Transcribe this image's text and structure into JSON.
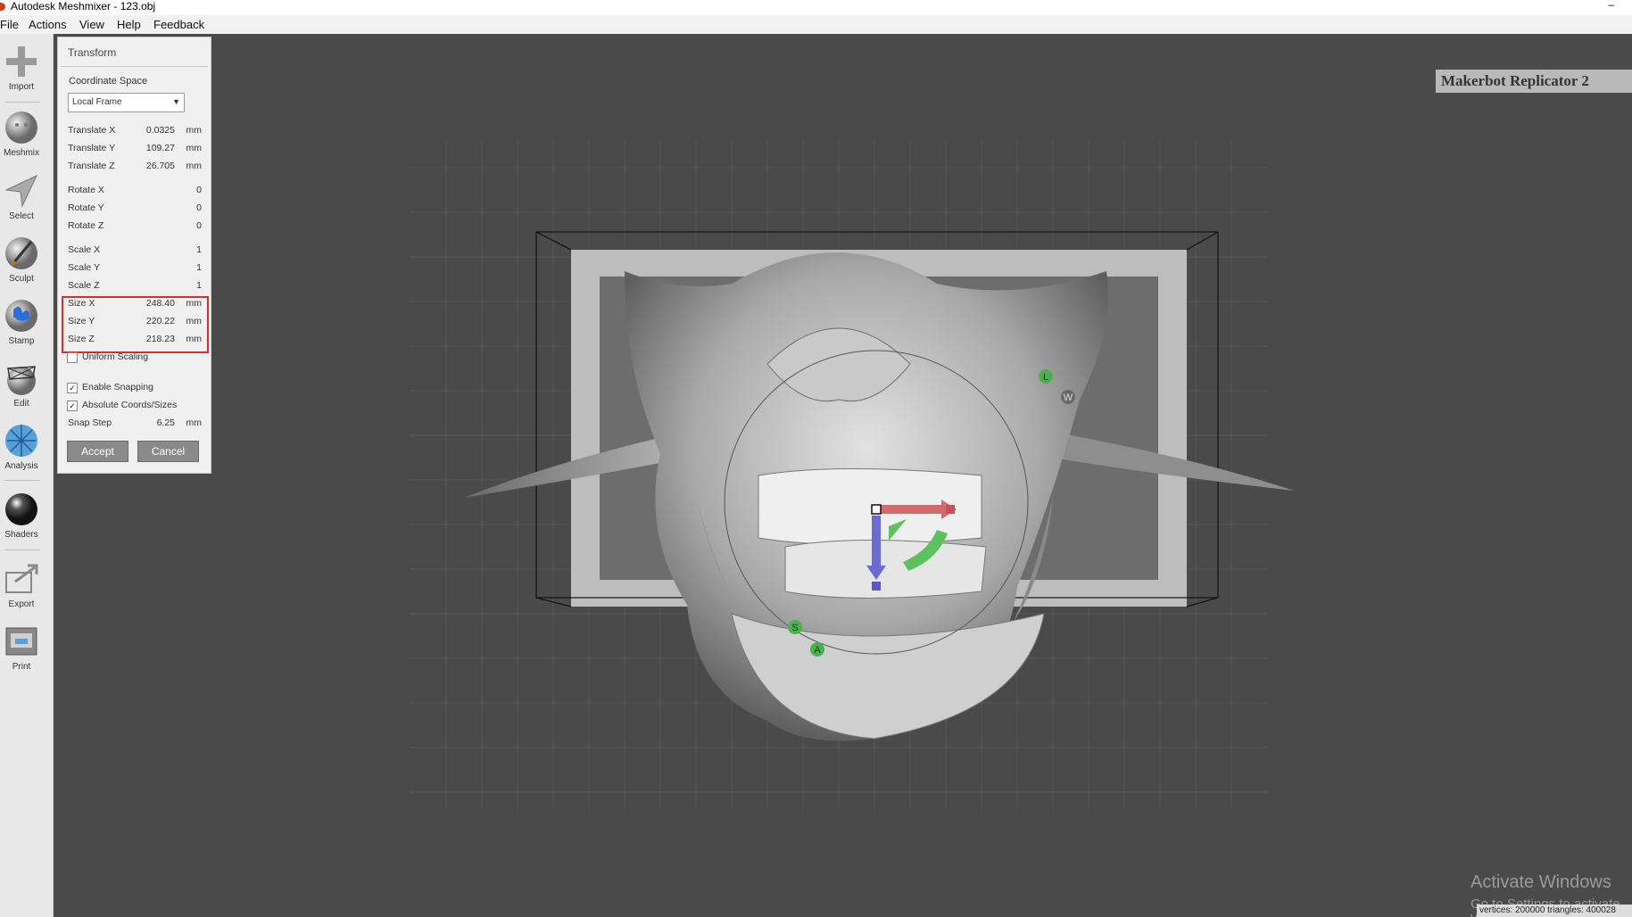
{
  "window": {
    "title": "Autodesk Meshmixer - 123.obj",
    "minimize": "–"
  },
  "menu": [
    "File",
    "Actions",
    "View",
    "Help",
    "Feedback"
  ],
  "tools": [
    {
      "label": "Import",
      "icon": "plus-icon"
    },
    {
      "label": "Meshmix",
      "icon": "meshmix-icon"
    },
    {
      "label": "Select",
      "icon": "select-arrow-icon"
    },
    {
      "label": "Sculpt",
      "icon": "sculpt-brush-icon"
    },
    {
      "label": "Stamp",
      "icon": "stamp-icon"
    },
    {
      "label": "Edit",
      "icon": "edit-icon"
    },
    {
      "label": "Analysis",
      "icon": "analysis-icon"
    },
    {
      "label": "Shaders",
      "icon": "shaders-sphere-icon"
    },
    {
      "label": "Export",
      "icon": "export-icon"
    },
    {
      "label": "Print",
      "icon": "printer-icon"
    }
  ],
  "transform_panel": {
    "title": "Transform",
    "coordinate_space_label": "Coordinate Space",
    "coordinate_space_value": "Local Frame",
    "translate": [
      {
        "label": "Translate X",
        "value": "0.0325",
        "unit": "mm"
      },
      {
        "label": "Translate Y",
        "value": "109.27",
        "unit": "mm"
      },
      {
        "label": "Translate Z",
        "value": "26.705",
        "unit": "mm"
      }
    ],
    "rotate": [
      {
        "label": "Rotate X",
        "value": "0"
      },
      {
        "label": "Rotate Y",
        "value": "0"
      },
      {
        "label": "Rotate Z",
        "value": "0"
      }
    ],
    "scale": [
      {
        "label": "Scale X",
        "value": "1"
      },
      {
        "label": "Scale Y",
        "value": "1"
      },
      {
        "label": "Scale Z",
        "value": "1"
      }
    ],
    "size": [
      {
        "label": "Size X",
        "value": "248.40",
        "unit": "mm"
      },
      {
        "label": "Size Y",
        "value": "220.22",
        "unit": "mm"
      },
      {
        "label": "Size Z",
        "value": "218.23",
        "unit": "mm"
      }
    ],
    "uniform_scaling_label": "Uniform Scaling",
    "uniform_scaling_checked": false,
    "enable_snapping_label": "Enable Snapping",
    "enable_snapping_checked": true,
    "absolute_coords_label": "Absolute Coords/Sizes",
    "absolute_coords_checked": true,
    "snap_step_label": "Snap Step",
    "snap_step_value": "6.25",
    "snap_step_unit": "mm",
    "accept_label": "Accept",
    "cancel_label": "Cancel",
    "highlight_color": "#d32f2f"
  },
  "viewport": {
    "printer": "Makerbot Replicator 2",
    "gizmo_labels": {
      "l": "L",
      "w": "W",
      "s": "S",
      "a": "A"
    },
    "background_color": "#4a4a4a"
  },
  "watermark": {
    "line1": "Activate Windows",
    "line2": "Go to Settings to activate Windows."
  },
  "status": "vertices: 200000 triangles: 400028"
}
